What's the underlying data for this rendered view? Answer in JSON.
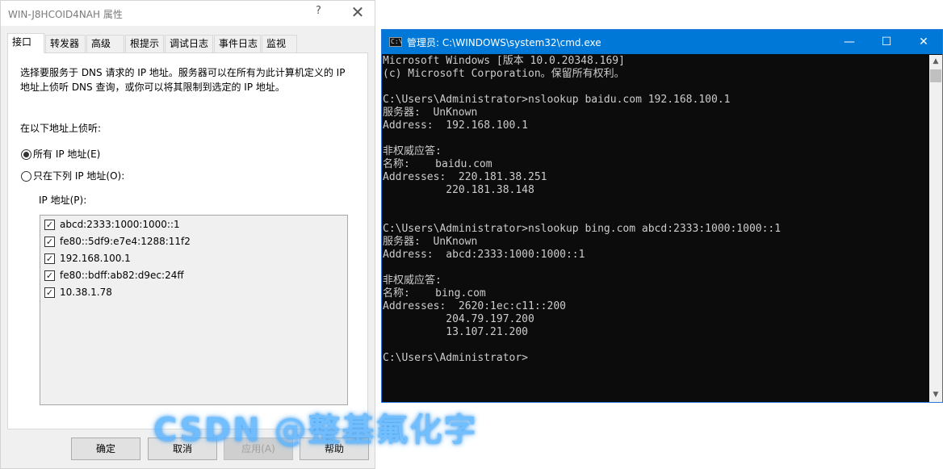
{
  "dialog": {
    "title": "WIN-J8HCOID4NAH 属性",
    "help_glyph": "?",
    "close_glyph": "✕",
    "tabs": [
      {
        "label": "接口",
        "active": true
      },
      {
        "label": "转发器",
        "active": false
      },
      {
        "label": "高级",
        "active": false
      },
      {
        "label": "根提示",
        "active": false
      },
      {
        "label": "调试日志",
        "active": false
      },
      {
        "label": "事件日志",
        "active": false
      },
      {
        "label": "监视",
        "active": false
      }
    ],
    "description_line1": "选择要服务于 DNS 请求的 IP 地址。服务器可以在所有为此计算机定义的 IP",
    "description_line2": "地址上侦听 DNS 查询，或你可以将其限制到选定的 IP 地址。",
    "listen_label": "在以下地址上侦听:",
    "radio_all": {
      "label": "所有 IP 地址(E)",
      "selected": true
    },
    "radio_only": {
      "label": "只在下列 IP 地址(O):",
      "selected": false
    },
    "ip_list_label": "IP 地址(P):",
    "ip_addresses": [
      {
        "address": "abcd:2333:1000:1000::1",
        "checked": true
      },
      {
        "address": "fe80::5df9:e7e4:1288:11f2",
        "checked": true
      },
      {
        "address": "192.168.100.1",
        "checked": true
      },
      {
        "address": "fe80::bdff:ab82:d9ec:24ff",
        "checked": true
      },
      {
        "address": "10.38.1.78",
        "checked": true
      }
    ],
    "check_glyph": "✓",
    "buttons": {
      "ok": "确定",
      "cancel": "取消",
      "apply": "应用(A)",
      "help": "帮助"
    }
  },
  "cmd": {
    "title": "管理员: C:\\WINDOWS\\system32\\cmd.exe",
    "icon_text": "C:\\",
    "minimize_glyph": "—",
    "maximize_glyph": "☐",
    "close_glyph": "✕",
    "scroll_up_glyph": "▲",
    "scroll_down_glyph": "▼",
    "lines": [
      "Microsoft Windows [版本 10.0.20348.169]",
      "(c) Microsoft Corporation。保留所有权利。",
      "",
      "C:\\Users\\Administrator>nslookup baidu.com 192.168.100.1",
      "服务器:  UnKnown",
      "Address:  192.168.100.1",
      "",
      "非权威应答:",
      "名称:    baidu.com",
      "Addresses:  220.181.38.251",
      "          220.181.38.148",
      "",
      "",
      "C:\\Users\\Administrator>nslookup bing.com abcd:2333:1000:1000::1",
      "服务器:  UnKnown",
      "Address:  abcd:2333:1000:1000::1",
      "",
      "非权威应答:",
      "名称:    bing.com",
      "Addresses:  2620:1ec:c11::200",
      "          204.79.197.200",
      "          13.107.21.200",
      "",
      "C:\\Users\\Administrator>"
    ]
  },
  "watermark": "CSDN @整基氟化字"
}
